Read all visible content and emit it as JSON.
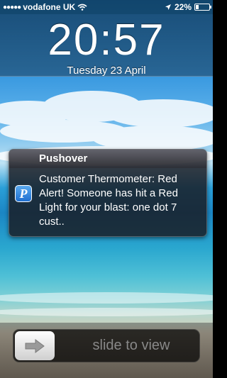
{
  "status_bar": {
    "carrier": "vodafone UK",
    "battery_text": "22%",
    "battery_level": 0.22,
    "icons": [
      "signal-icon",
      "wifi-icon",
      "location-arrow-icon",
      "battery-icon"
    ]
  },
  "lock_screen": {
    "time": "20:57",
    "date": "Tuesday 23 April"
  },
  "notification": {
    "app_name": "Pushover",
    "app_icon_letter": "P",
    "message": "Customer Thermometer: Red Alert! Someone has hit a Red Light for your blast: one dot 7 cust.."
  },
  "slider": {
    "label": "slide to view",
    "knob_icon": "arrow-right-icon"
  },
  "colors": {
    "accent_icon": "#1e6fd0"
  }
}
